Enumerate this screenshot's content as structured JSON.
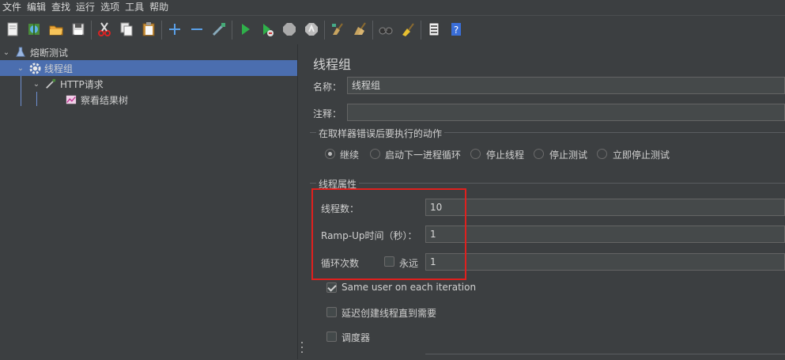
{
  "menu": [
    "文件",
    "编辑",
    "查找",
    "运行",
    "选项",
    "工具",
    "帮助"
  ],
  "toolbar": {
    "icons": [
      "new-icon",
      "templates-icon",
      "open-icon",
      "save-icon",
      "cut-icon",
      "copy-icon",
      "paste-icon",
      "expand-icon",
      "collapse-icon",
      "toggle-icon",
      "start-icon",
      "start-no-pause-icon",
      "stop-icon",
      "shutdown-icon",
      "clear-icon",
      "clear-all-icon",
      "search-icon",
      "reset-search-icon",
      "function-helper-icon",
      "help-icon"
    ]
  },
  "tree": {
    "root": "熔断测试",
    "thread_group": "线程组",
    "http_request": "HTTP请求",
    "result_tree": "察看结果树"
  },
  "panel": {
    "title": "线程组",
    "name_label": "名称：",
    "name_value": "线程组",
    "comment_label": "注释：",
    "comment_value": "",
    "sampler_error_title": "在取样器错误后要执行的动作",
    "actions": [
      "继续",
      "启动下一进程循环",
      "停止线程",
      "停止测试",
      "立即停止测试"
    ],
    "selected_action": "继续",
    "props_title": "线程属性",
    "threads_label": "线程数：",
    "threads_value": "10",
    "rampup_label": "Ramp-Up时间（秒）：",
    "rampup_value": "1",
    "loop_label": "循环次数",
    "forever_label": "永远",
    "forever_checked": false,
    "loop_value": "1",
    "same_user_label": "Same user on each iteration",
    "same_user_checked": true,
    "delay_label": "延迟创建线程直到需要",
    "delay_checked": false,
    "scheduler_label": "调度器",
    "scheduler_checked": false
  },
  "colors": {
    "background": "#3c3f41",
    "selection": "#4b6eaf",
    "highlight_box": "#e0201e"
  }
}
